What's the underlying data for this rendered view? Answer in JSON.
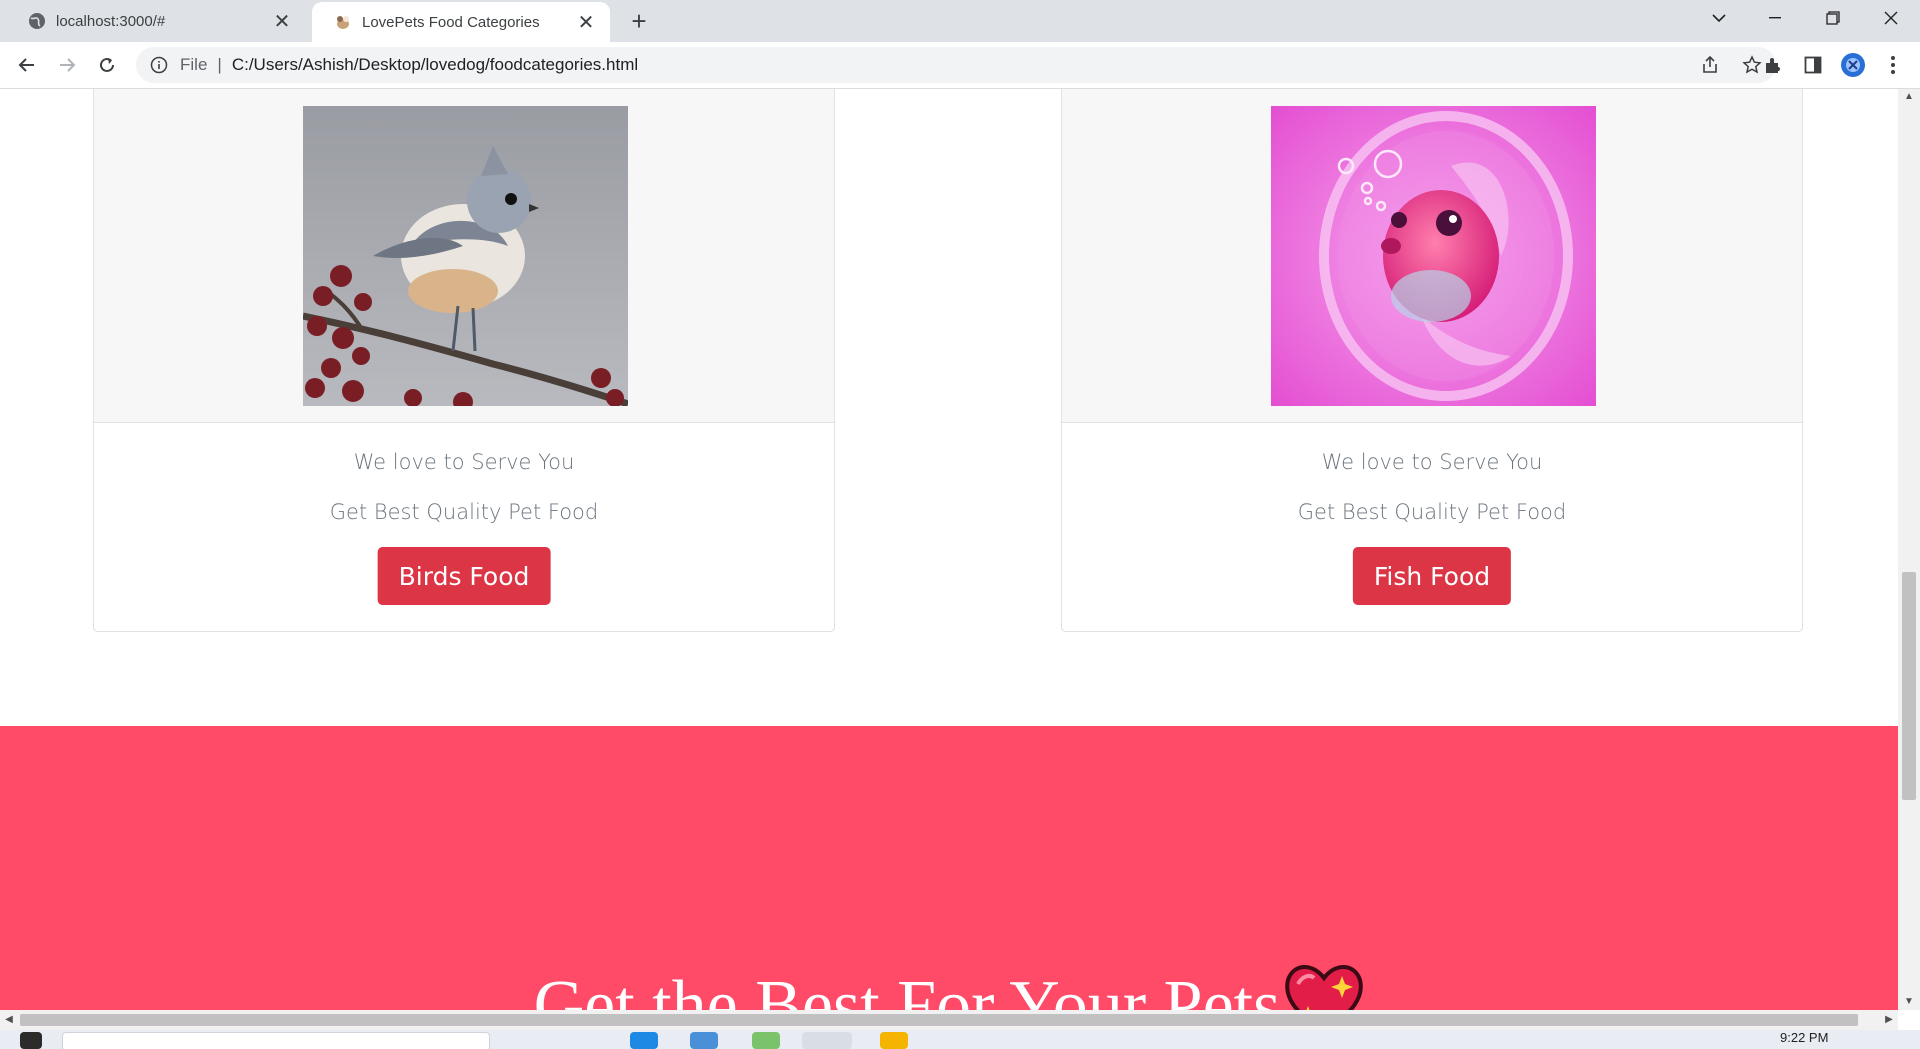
{
  "browser": {
    "tabs": [
      {
        "title": "localhost:3000/#",
        "active": false,
        "icon": "globe-icon"
      },
      {
        "title": "LovePets Food Categories",
        "active": true,
        "icon": "pet-favicon"
      }
    ],
    "address": {
      "scheme_label": "File",
      "url": "C:/Users/Ashish/Desktop/lovedog/foodcategories.html"
    }
  },
  "page": {
    "cards": [
      {
        "image": "tufted-titmouse-bird",
        "line1": "We love to Serve You",
        "line2": "Get Best Quality Pet Food",
        "button_label": "Birds Food"
      },
      {
        "image": "pink-fish-in-bubble",
        "line1": "We love to Serve You",
        "line2": "Get Best Quality Pet Food",
        "button_label": "Fish Food"
      }
    ],
    "banner": {
      "headline": "Get the Best For Your Pets",
      "emoji": "sparkling-heart"
    }
  },
  "taskbar": {
    "clock": "9:22 PM"
  },
  "colors": {
    "button_red": "#dc3545",
    "banner_pink": "#ff4a68",
    "card_image_bg": "#f7f7f7",
    "muted_text": "#6c757d"
  }
}
